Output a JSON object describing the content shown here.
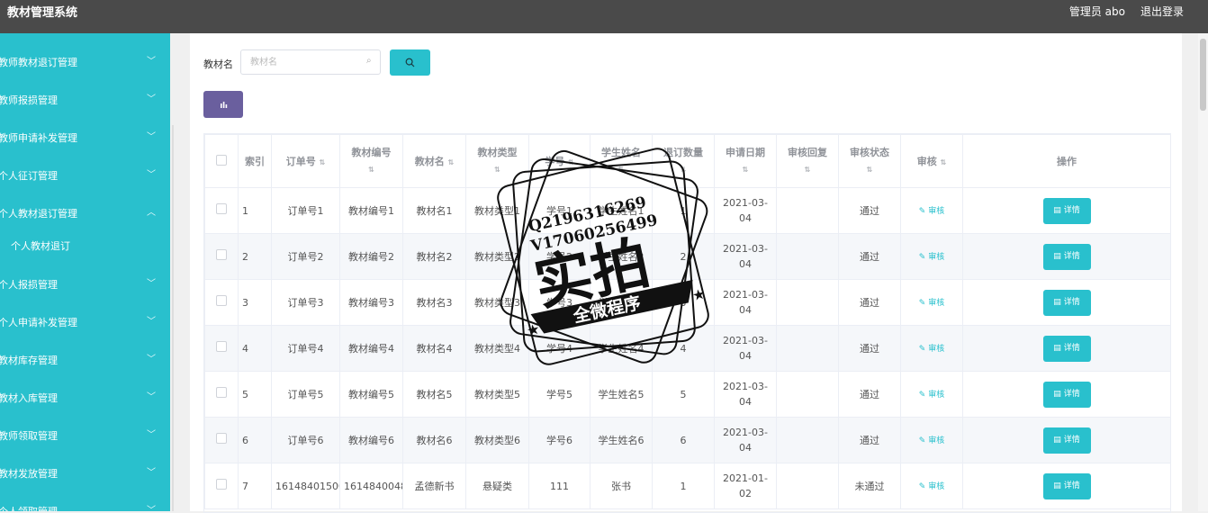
{
  "header": {
    "app_title": "教材管理系统",
    "user_label": "管理员 abo",
    "logout_label": "退出登录"
  },
  "sidebar": {
    "items": [
      {
        "label": "教师教材退订管理",
        "expanded": false
      },
      {
        "label": "教师报损管理",
        "expanded": false
      },
      {
        "label": "教师申请补发管理",
        "expanded": false
      },
      {
        "label": "个人征订管理",
        "expanded": false
      },
      {
        "label": "个人教材退订管理",
        "expanded": true,
        "sub": [
          "个人教材退订"
        ]
      },
      {
        "label": "个人报损管理",
        "expanded": false
      },
      {
        "label": "个人申请补发管理",
        "expanded": false
      },
      {
        "label": "教材库存管理",
        "expanded": false
      },
      {
        "label": "教材入库管理",
        "expanded": false
      },
      {
        "label": "教师领取管理",
        "expanded": false
      },
      {
        "label": "教材发放管理",
        "expanded": false
      },
      {
        "label": "个人领取管理",
        "expanded": false
      }
    ]
  },
  "search": {
    "label": "教材名",
    "placeholder": "教材名"
  },
  "table": {
    "headers": {
      "index": "索引",
      "order_no": "订单号",
      "material_no": "教材编号",
      "material_name": "教材名",
      "material_type": "教材类型",
      "student_no": "学号",
      "student_name": "学生姓名",
      "quantity": "退订数量",
      "apply_date": "申请日期",
      "reply": "审核回复",
      "status": "审核状态",
      "review": "审核",
      "actions": "操作"
    },
    "review_label": "审核",
    "detail_label": "详情",
    "rows": [
      {
        "index": "1",
        "order_no": "订单号1",
        "material_no": "教材编号1",
        "material_name": "教材名1",
        "material_type": "教材类型1",
        "student_no": "学号1",
        "student_name": "学生姓名1",
        "quantity": "1",
        "apply_date": "2021-03-04",
        "reply": "",
        "status": "通过"
      },
      {
        "index": "2",
        "order_no": "订单号2",
        "material_no": "教材编号2",
        "material_name": "教材名2",
        "material_type": "教材类型2",
        "student_no": "学号2",
        "student_name": "学生姓名2",
        "quantity": "2",
        "apply_date": "2021-03-04",
        "reply": "",
        "status": "通过"
      },
      {
        "index": "3",
        "order_no": "订单号3",
        "material_no": "教材编号3",
        "material_name": "教材名3",
        "material_type": "教材类型3",
        "student_no": "学号3",
        "student_name": "学生姓名3",
        "quantity": "3",
        "apply_date": "2021-03-04",
        "reply": "",
        "status": "通过"
      },
      {
        "index": "4",
        "order_no": "订单号4",
        "material_no": "教材编号4",
        "material_name": "教材名4",
        "material_type": "教材类型4",
        "student_no": "学号4",
        "student_name": "学生姓名4",
        "quantity": "4",
        "apply_date": "2021-03-04",
        "reply": "",
        "status": "通过"
      },
      {
        "index": "5",
        "order_no": "订单号5",
        "material_no": "教材编号5",
        "material_name": "教材名5",
        "material_type": "教材类型5",
        "student_no": "学号5",
        "student_name": "学生姓名5",
        "quantity": "5",
        "apply_date": "2021-03-04",
        "reply": "",
        "status": "通过"
      },
      {
        "index": "6",
        "order_no": "订单号6",
        "material_no": "教材编号6",
        "material_name": "教材名6",
        "material_type": "教材类型6",
        "student_no": "学号6",
        "student_name": "学生姓名6",
        "quantity": "6",
        "apply_date": "2021-03-04",
        "reply": "",
        "status": "通过"
      },
      {
        "index": "7",
        "order_no": "1614840150000",
        "material_no": "1614840048027",
        "material_name": "孟德新书",
        "material_type": "悬疑类",
        "student_no": "111",
        "student_name": "张书",
        "quantity": "1",
        "apply_date": "2021-01-02",
        "reply": "",
        "status": "未通过"
      }
    ]
  },
  "watermark": {
    "line1": "Q2196316269",
    "line2": "V17060256499",
    "big_text": "实拍",
    "banner_text": "全微程序"
  },
  "colors": {
    "accent": "#29c0cd",
    "topbar": "#4a4a4a",
    "chart_button": "#6a5f9e"
  }
}
